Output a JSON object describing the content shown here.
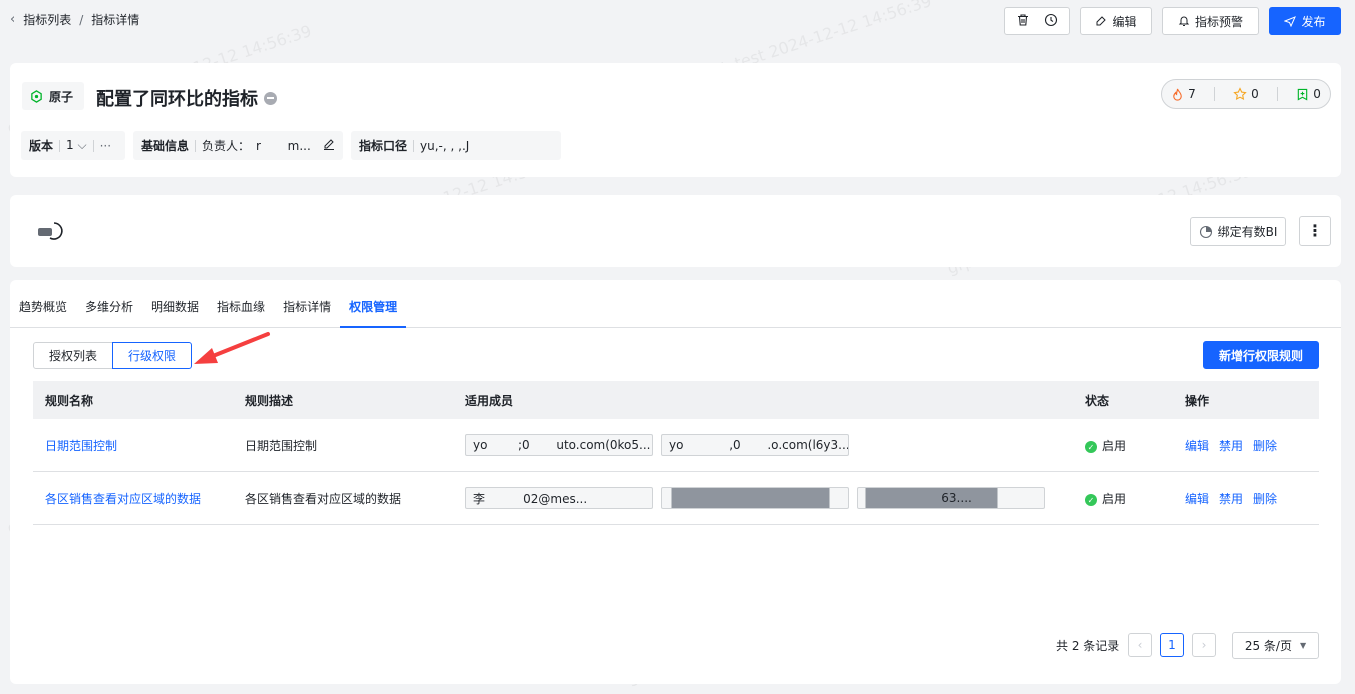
{
  "breadcrumb": {
    "back_icon": "chevron-left-icon",
    "parent": "指标列表",
    "separator": "/",
    "current": "指标详情"
  },
  "toolbar": {
    "edit": "编辑",
    "alert": "指标预警",
    "publish": "发布"
  },
  "metric": {
    "type_label": "原子",
    "title": "配置了同环比的指标",
    "version_label": "版本",
    "version_value": "1",
    "basic_label": "基础信息",
    "owner_label": "负责人：",
    "owner_value": "r       m...",
    "caliber_label": "指标口径",
    "caliber_value": "yu,-, , ,.J"
  },
  "stats": {
    "hot": "7",
    "star": "0",
    "bookmark": "0"
  },
  "bind_bi": "绑定有数BI",
  "tabs": [
    {
      "label": "趋势概览",
      "active": false
    },
    {
      "label": "多维分析",
      "active": false
    },
    {
      "label": "明细数据",
      "active": false
    },
    {
      "label": "指标血缘",
      "active": false
    },
    {
      "label": "指标详情",
      "active": false
    },
    {
      "label": "权限管理",
      "active": true
    }
  ],
  "segments": {
    "list": "授权列表",
    "row": "行级权限"
  },
  "add_rule": "新增行权限规则",
  "table": {
    "headers": [
      "规则名称",
      "规则描述",
      "适用成员",
      "状态",
      "操作"
    ],
    "rows": [
      {
        "name": "日期范围控制",
        "desc": "日期范围控制",
        "members": [
          "yo        ;0       uto.com(0ko5...",
          "yo            ,0       .o.com(l6y3..."
        ],
        "status": "启用",
        "actions": [
          "编辑",
          "禁用",
          "删除"
        ]
      },
      {
        "name": "各区销售查看对应区域的数据",
        "desc": "各区销售查看对应区域的数据",
        "members": [
          "李          02@mes...",
          "                              ",
          "                    63...."
        ],
        "status": "启用",
        "actions": [
          "编辑",
          "禁用",
          "删除"
        ]
      }
    ]
  },
  "pagination": {
    "total": "共 2 条记录",
    "page": "1",
    "page_size": "25 条/页"
  },
  "watermark": "grp.mammut_test 2024-12-12 14:56:39",
  "colors": {
    "primary": "#1664ff",
    "success": "#34c759",
    "bg": "#f2f3f5"
  }
}
